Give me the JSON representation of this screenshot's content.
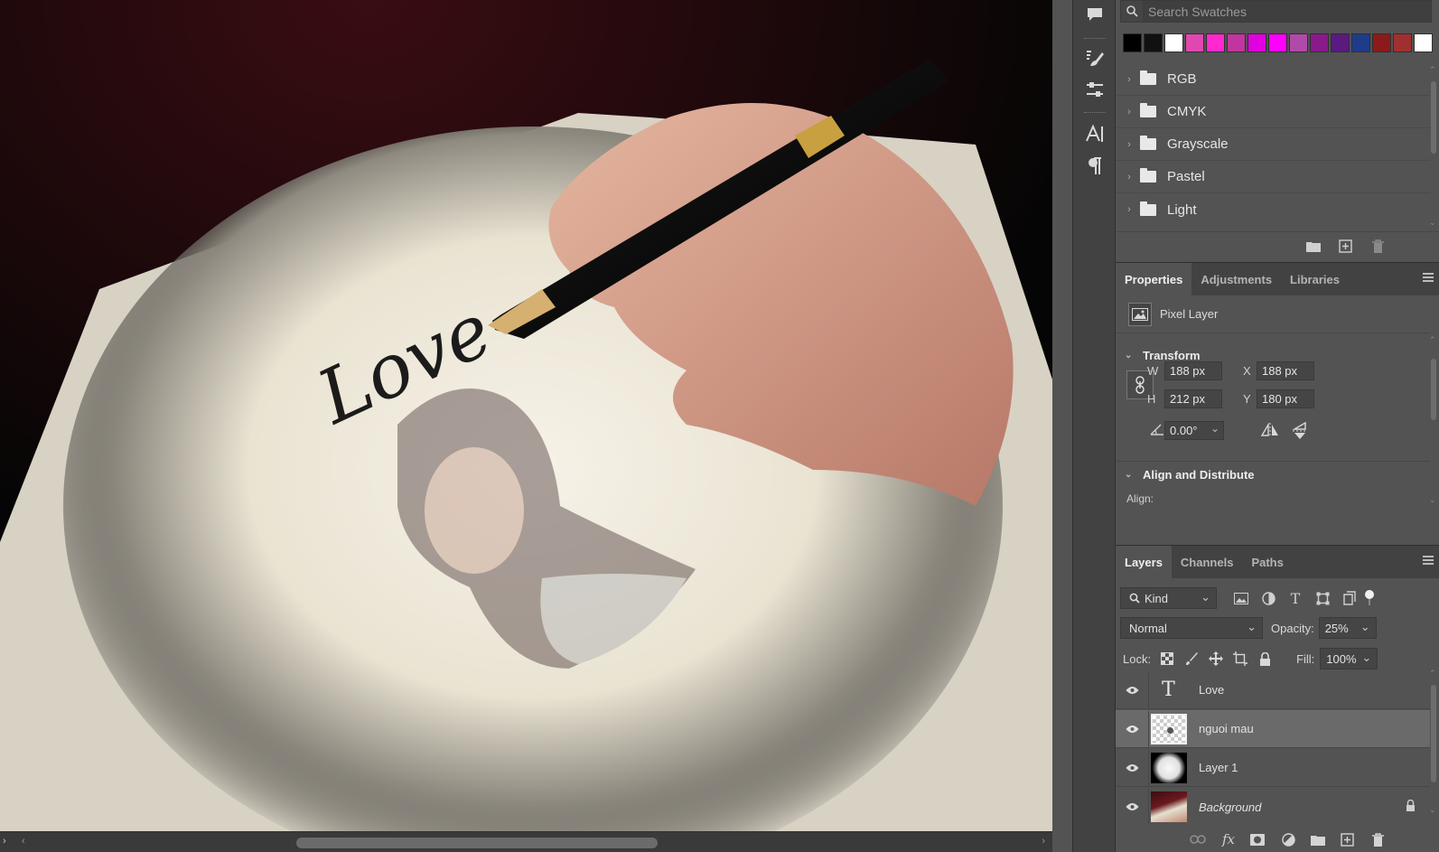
{
  "canvas": {
    "text_art": "Love"
  },
  "swatches": {
    "search_placeholder": "Search Swatches",
    "colors": [
      "#000000",
      "#111111",
      "#ffffff",
      "#e048b0",
      "#ff29cf",
      "#c0369e",
      "#e000e0",
      "#ff00ff",
      "#b04aa8",
      "#8a1a8a",
      "#5a1a80",
      "#1f3c8a",
      "#8c1a1a",
      "#a03030",
      "#ffffff"
    ],
    "groups": [
      "RGB",
      "CMYK",
      "Grayscale",
      "Pastel",
      "Light"
    ]
  },
  "properties": {
    "tabs": [
      "Properties",
      "Adjustments",
      "Libraries"
    ],
    "layer_type": "Pixel Layer",
    "transform": {
      "title": "Transform",
      "w_label": "W",
      "w": "188 px",
      "h_label": "H",
      "h": "212 px",
      "x_label": "X",
      "x": "188 px",
      "y_label": "Y",
      "y": "180 px",
      "angle": "0.00°"
    },
    "align": {
      "title": "Align and Distribute",
      "label": "Align:"
    }
  },
  "layers": {
    "tabs": [
      "Layers",
      "Channels",
      "Paths"
    ],
    "kind": "Kind",
    "blend_mode": "Normal",
    "opacity_label": "Opacity:",
    "opacity": "25%",
    "lock_label": "Lock:",
    "fill_label": "Fill:",
    "fill": "100%",
    "items": [
      {
        "name": "Love",
        "type": "text",
        "selected": false
      },
      {
        "name": "nguoi mau",
        "type": "transparent",
        "selected": true
      },
      {
        "name": "Layer 1",
        "type": "mask",
        "selected": false
      },
      {
        "name": "Background",
        "type": "photo",
        "selected": false
      }
    ]
  }
}
